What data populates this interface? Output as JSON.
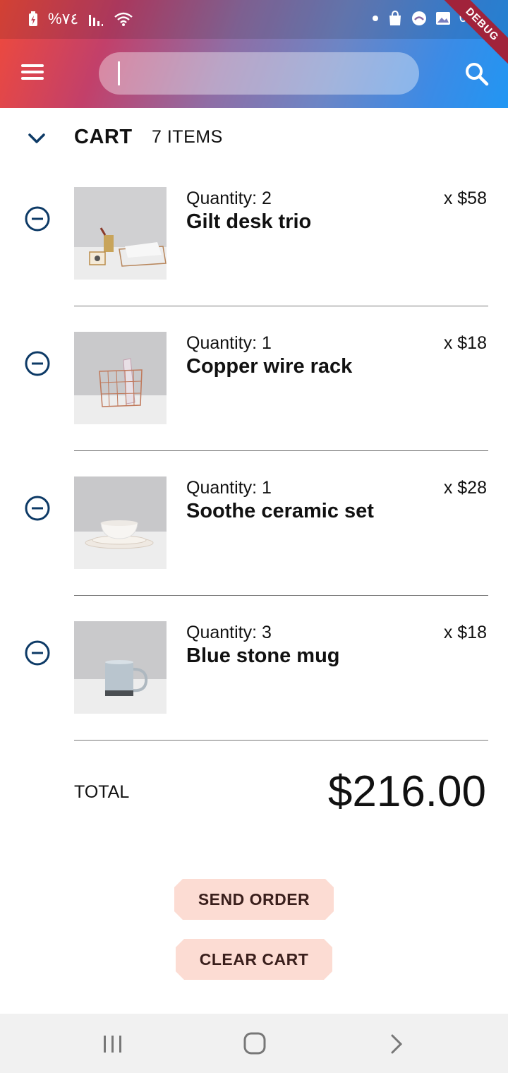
{
  "status_bar": {
    "battery_percent": "%٧٤",
    "debug_label": "DEBUG",
    "right_text": "0"
  },
  "app_bar": {
    "search_placeholder": ""
  },
  "cart": {
    "title": "CART",
    "count_label": "7 ITEMS",
    "items": [
      {
        "quantity_label": "Quantity: 2",
        "name": "Gilt desk trio",
        "price_label": "x $58"
      },
      {
        "quantity_label": "Quantity: 1",
        "name": "Copper wire rack",
        "price_label": "x $18"
      },
      {
        "quantity_label": "Quantity: 1",
        "name": "Soothe ceramic set",
        "price_label": "x $28"
      },
      {
        "quantity_label": "Quantity: 3",
        "name": "Blue stone mug",
        "price_label": "x $18"
      }
    ],
    "total_label": "TOTAL",
    "total_value": "$216.00"
  },
  "actions": {
    "send_order_label": "SEND ORDER",
    "clear_cart_label": "CLEAR CART"
  },
  "colors": {
    "gradient_start": "#f04a3b",
    "gradient_end": "#2196f3",
    "button_bg": "#fcdcd3",
    "icon_accent": "#0d3a66"
  },
  "icons": {
    "menu": "menu-icon",
    "search": "search-icon",
    "collapse": "chevron-down-icon",
    "remove": "remove-circle-icon"
  }
}
